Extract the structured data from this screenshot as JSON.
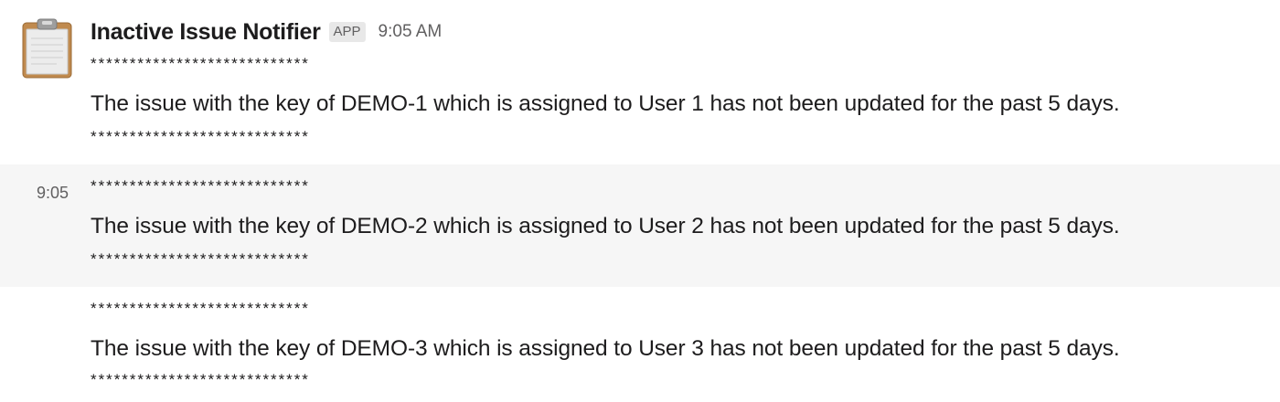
{
  "sender": {
    "name": "Inactive Issue Notifier",
    "badge": "APP",
    "time": "9:05 AM",
    "avatar_icon": "clipboard-icon"
  },
  "messages": [
    {
      "side_time": "",
      "separator_top": "****************************",
      "text": "The issue with the key of DEMO-1 which is assigned to User 1 has not been updated for the past 5 days.",
      "separator_bottom": "****************************"
    },
    {
      "side_time": "9:05",
      "separator_top": "****************************",
      "text": "The issue with the key of DEMO-2 which is assigned to User 2 has not been updated for the past 5 days.",
      "separator_bottom": "****************************"
    },
    {
      "side_time": "",
      "separator_top": "****************************",
      "text": "The issue with the key of DEMO-3 which is assigned to User 3 has not been updated for the past 5 days.",
      "separator_bottom": "****************************"
    }
  ],
  "colors": {
    "hover_row": "#f6f6f6",
    "text": "#1d1c1d",
    "muted": "#616061",
    "badge_bg": "#e8e8e8",
    "clipboard_board": "#c08a4e",
    "clipboard_paper": "#e9e9e9"
  }
}
